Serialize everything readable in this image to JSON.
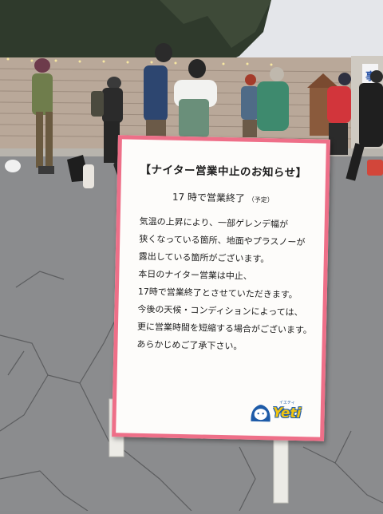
{
  "sign": {
    "title": "【ナイター営業中止のお知らせ】",
    "subtitle": "17 時で営業終了",
    "subtitle_note": "（予定）",
    "lines": [
      "気温の上昇により、一部ゲレンデ幅が",
      "狭くなっている箇所、地面やプラスノーが",
      "露出している箇所がございます。",
      "本日のナイター営業は中止、",
      "17時で営業終了とさせていただきます。",
      "今後の天候・コンディションによっては、",
      "更に営業時間を短縮する場合がございます。",
      "あらかじめご了承下さい。"
    ],
    "border_color": "#ee6f88"
  },
  "logo": {
    "text": "Yeti",
    "ruby": "イエティ",
    "colors": {
      "fill": "#f1c40f",
      "outline": "#1e5ba8"
    }
  },
  "scene": {
    "background_sign_text": "事"
  }
}
